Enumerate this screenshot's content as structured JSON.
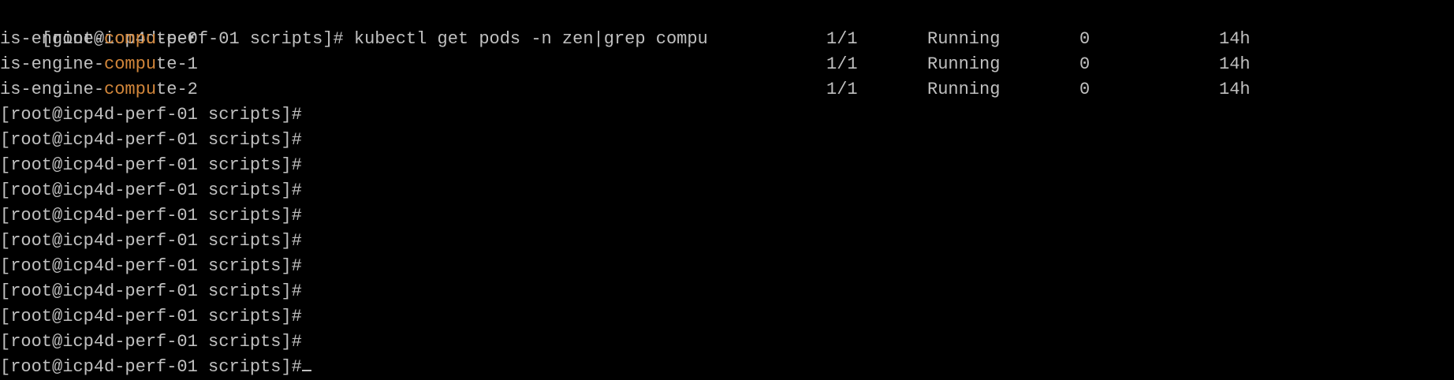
{
  "colors": {
    "background": "#000000",
    "foreground": "#c0c0c0",
    "match_highlight": "#d2863a"
  },
  "command_line": {
    "prompt": "[root@icp4d-perf-01 scripts]#",
    "command": "kubectl get pods -n zen|grep compu"
  },
  "pods": [
    {
      "name_prefix": "is-engine-",
      "match": "compu",
      "name_suffix": "te-0",
      "ready": "1/1",
      "status": "Running",
      "restarts": "0",
      "age": "14h"
    },
    {
      "name_prefix": "is-engine-",
      "match": "compu",
      "name_suffix": "te-1",
      "ready": "1/1",
      "status": "Running",
      "restarts": "0",
      "age": "14h"
    },
    {
      "name_prefix": "is-engine-",
      "match": "compu",
      "name_suffix": "te-2",
      "ready": "1/1",
      "status": "Running",
      "restarts": "0",
      "age": "14h"
    }
  ],
  "prompt_lines": [
    "[root@icp4d-perf-01 scripts]#",
    "[root@icp4d-perf-01 scripts]#",
    "[root@icp4d-perf-01 scripts]#",
    "[root@icp4d-perf-01 scripts]#",
    "[root@icp4d-perf-01 scripts]#",
    "[root@icp4d-perf-01 scripts]#",
    "[root@icp4d-perf-01 scripts]#",
    "[root@icp4d-perf-01 scripts]#",
    "[root@icp4d-perf-01 scripts]#",
    "[root@icp4d-perf-01 scripts]#",
    "[root@icp4d-perf-01 scripts]#"
  ]
}
